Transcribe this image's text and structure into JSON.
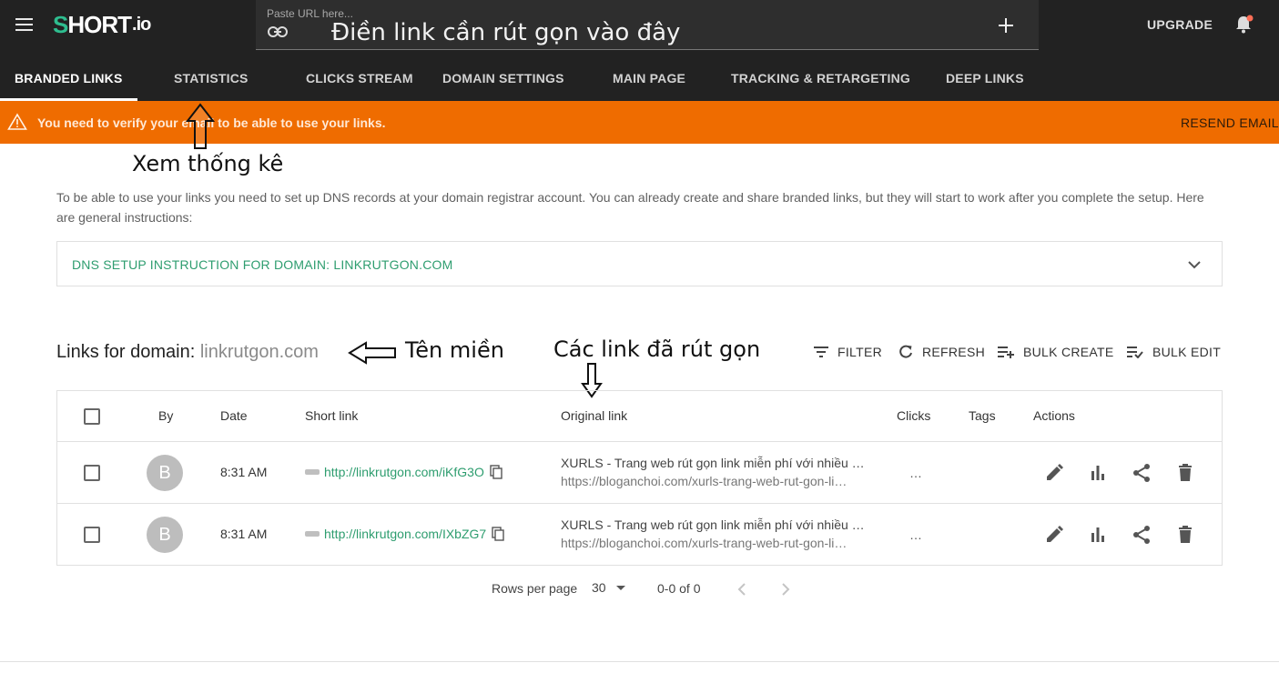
{
  "app": {
    "logo_mark": "S",
    "logo_text": "HORT",
    "logo_suffix": ".io"
  },
  "search": {
    "placeholder": "Paste URL here...",
    "value": "Điền link cần rút gọn vào đây"
  },
  "header": {
    "upgrade_label": "UPGRADE"
  },
  "tabs": [
    {
      "label": "BRANDED LINKS",
      "active": true
    },
    {
      "label": "STATISTICS",
      "active": false
    },
    {
      "label": "CLICKS STREAM",
      "active": false
    },
    {
      "label": "DOMAIN SETTINGS",
      "active": false
    },
    {
      "label": "MAIN PAGE",
      "active": false
    },
    {
      "label": "TRACKING & RETARGETING",
      "active": false
    },
    {
      "label": "DEEP LINKS",
      "active": false
    }
  ],
  "banner": {
    "message": "You need to verify your email to be able to use your links.",
    "action": "RESEND EMAIL",
    "color": "#ef6c00"
  },
  "annotations": {
    "statistics_note": "Xem thống kê",
    "domain_note": "Tên miền",
    "links_note": "Các link đã rút gọn"
  },
  "dns": {
    "info": "To be able to use your links you need to set up DNS records at your domain registrar account. You can already create and share branded links, but they will start to work after you complete the setup. Here are general instructions:",
    "panel_title": "DNS SETUP INSTRUCTION FOR DOMAIN: LINKRUTGON.COM"
  },
  "links": {
    "title_prefix": "Links for domain: ",
    "domain": "linkrutgon.com",
    "toolbar": {
      "filter": "FILTER",
      "refresh": "REFRESH",
      "bulk_create": "BULK CREATE",
      "bulk_edit": "BULK EDIT"
    }
  },
  "table": {
    "columns": {
      "by": "By",
      "date": "Date",
      "short": "Short link",
      "original": "Original link",
      "clicks": "Clicks",
      "tags": "Tags",
      "actions": "Actions"
    },
    "rows": [
      {
        "by": "B",
        "date": "8:31 AM",
        "short_link": "http://linkrutgon.com/iKfG3O",
        "original_title": "XURLS - Trang web rút gọn link miễn phí với nhiều …",
        "original_url": "https://bloganchoi.com/xurls-trang-web-rut-gon-li…",
        "clicks": "…"
      },
      {
        "by": "B",
        "date": "8:31 AM",
        "short_link": "http://linkrutgon.com/IXbZG7",
        "original_title": "XURLS - Trang web rút gọn link miễn phí với nhiều …",
        "original_url": "https://bloganchoi.com/xurls-trang-web-rut-gon-li…",
        "clicks": "…"
      }
    ]
  },
  "pagination": {
    "rows_label": "Rows per page",
    "rows_value": "30",
    "range": "0-0 of 0"
  },
  "colors": {
    "accent": "#2e9d6f",
    "topbar": "#222222"
  }
}
